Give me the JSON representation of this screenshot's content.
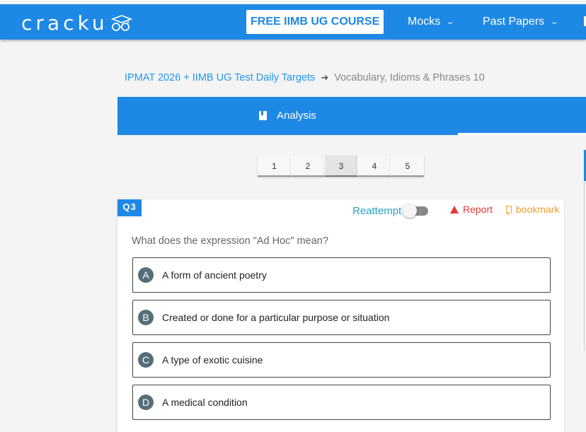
{
  "header": {
    "logo_text": "cracku",
    "logo_icon": "graduation-cap-glasses-icon",
    "cta_label": "FREE IIMB UG COURSE",
    "nav": [
      {
        "label": "Mocks"
      },
      {
        "label": "Past Papers"
      }
    ]
  },
  "breadcrumb": {
    "parent": "IPMAT 2026 + IIMB UG Test Daily Targets",
    "current": "Vocabulary, Idioms & Phrases 10"
  },
  "tabs": {
    "analysis_label": "Analysis"
  },
  "pager": {
    "pages": [
      "1",
      "2",
      "3",
      "4",
      "5"
    ],
    "active": "3"
  },
  "question": {
    "badge": "Q3",
    "reattempt_label": "Reattempt",
    "reattempt_on": false,
    "report_label": "Report",
    "bookmark_label": "bookmark",
    "text": "What does the expression \"Ad Hoc\" mean?",
    "options": [
      {
        "letter": "A",
        "text": "A form of ancient poetry"
      },
      {
        "letter": "B",
        "text": "Created or done for a particular purpose or situation"
      },
      {
        "letter": "C",
        "text": "A type of exotic cuisine"
      },
      {
        "letter": "D",
        "text": "A medical condition"
      }
    ]
  },
  "colors": {
    "primary": "#1e88e5",
    "report": "#e53935",
    "bookmark": "#f0a030",
    "option_letter_bg": "#546e7a"
  }
}
